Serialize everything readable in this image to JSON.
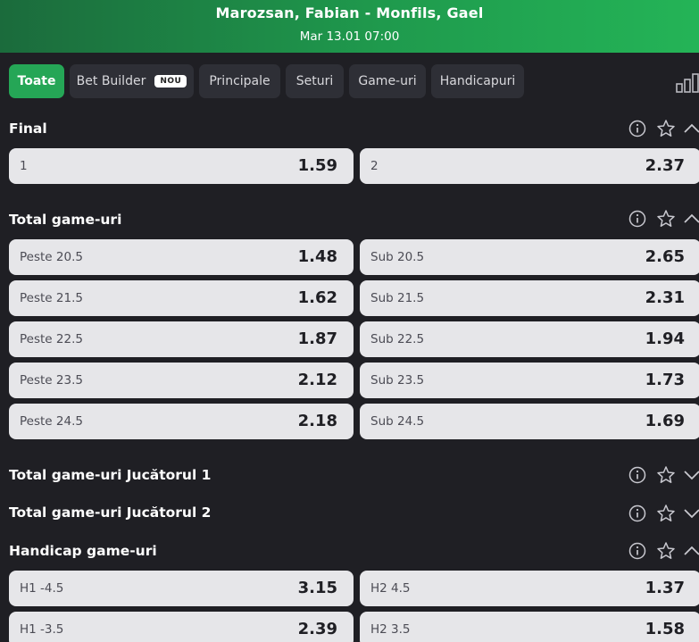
{
  "header": {
    "title": "Marozsan, Fabian - Monfils, Gael",
    "date": "Mar 13.01 07:00"
  },
  "tabs": [
    {
      "label": "Toate"
    },
    {
      "label": "Bet Builder",
      "badge": "NOU"
    },
    {
      "label": "Principale"
    },
    {
      "label": "Seturi"
    },
    {
      "label": "Game-uri"
    },
    {
      "label": "Handicapuri"
    }
  ],
  "sections": [
    {
      "title": "Final",
      "expanded": true,
      "rows": [
        {
          "left": {
            "label": "1",
            "odd": "1.59"
          },
          "right": {
            "label": "2",
            "odd": "2.37"
          }
        }
      ]
    },
    {
      "title": "Total game-uri",
      "expanded": true,
      "rows": [
        {
          "left": {
            "label": "Peste 20.5",
            "odd": "1.48"
          },
          "right": {
            "label": "Sub 20.5",
            "odd": "2.65"
          }
        },
        {
          "left": {
            "label": "Peste 21.5",
            "odd": "1.62"
          },
          "right": {
            "label": "Sub 21.5",
            "odd": "2.31"
          }
        },
        {
          "left": {
            "label": "Peste 22.5",
            "odd": "1.87"
          },
          "right": {
            "label": "Sub 22.5",
            "odd": "1.94"
          }
        },
        {
          "left": {
            "label": "Peste 23.5",
            "odd": "2.12"
          },
          "right": {
            "label": "Sub 23.5",
            "odd": "1.73"
          }
        },
        {
          "left": {
            "label": "Peste 24.5",
            "odd": "2.18"
          },
          "right": {
            "label": "Sub 24.5",
            "odd": "1.69"
          }
        }
      ]
    },
    {
      "title": "Total game-uri Jucătorul 1",
      "expanded": false
    },
    {
      "title": "Total game-uri Jucătorul 2",
      "expanded": false
    },
    {
      "title": "Handicap game-uri",
      "expanded": true,
      "rows": [
        {
          "left": {
            "label": "H1 -4.5",
            "odd": "3.15"
          },
          "right": {
            "label": "H2 4.5",
            "odd": "1.37"
          }
        },
        {
          "left": {
            "label": "H1 -3.5",
            "odd": "2.39"
          },
          "right": {
            "label": "H2 3.5",
            "odd": "1.58"
          }
        }
      ]
    }
  ],
  "colors": {
    "accent": "#25a656",
    "background": "#1f1f24",
    "button": "#e6e6e9",
    "tab": "#2e2f36"
  },
  "icons": {
    "info": "info-icon",
    "favorite": "star-icon",
    "collapse": "chevron-up-icon",
    "expand": "chevron-down-icon",
    "stats": "bar-chart-icon"
  }
}
